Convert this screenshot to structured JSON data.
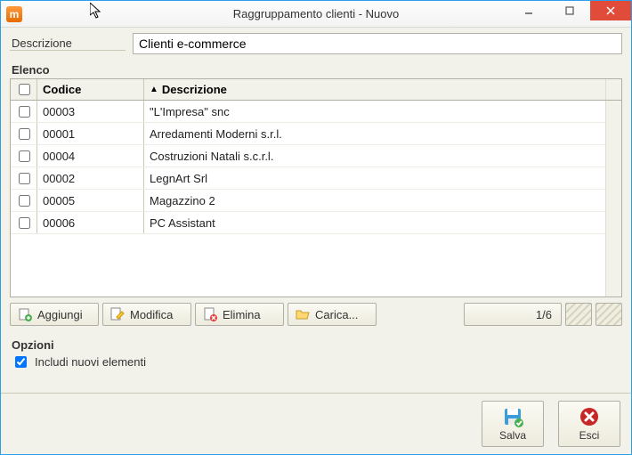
{
  "window": {
    "title": "Raggruppamento clienti - Nuovo"
  },
  "description": {
    "label": "Descrizione",
    "value": "Clienti e-commerce"
  },
  "list": {
    "title": "Elenco",
    "columns": {
      "code": "Codice",
      "description": "Descrizione"
    },
    "sort_indicator": "▲",
    "rows": [
      {
        "code": "00003",
        "description": "\"L'Impresa\" snc"
      },
      {
        "code": "00001",
        "description": "Arredamenti Moderni s.r.l."
      },
      {
        "code": "00004",
        "description": "Costruzioni Natali s.c.r.l."
      },
      {
        "code": "00002",
        "description": "LegnArt Srl"
      },
      {
        "code": "00005",
        "description": "Magazzino 2"
      },
      {
        "code": "00006",
        "description": "PC Assistant"
      }
    ]
  },
  "toolbar": {
    "add": "Aggiungi",
    "edit": "Modifica",
    "delete": "Elimina",
    "load": "Carica...",
    "counter": "1/6"
  },
  "options": {
    "title": "Opzioni",
    "include_new": "Includi nuovi elementi",
    "include_new_checked": true
  },
  "footer": {
    "save": "Salva",
    "exit": "Esci"
  }
}
